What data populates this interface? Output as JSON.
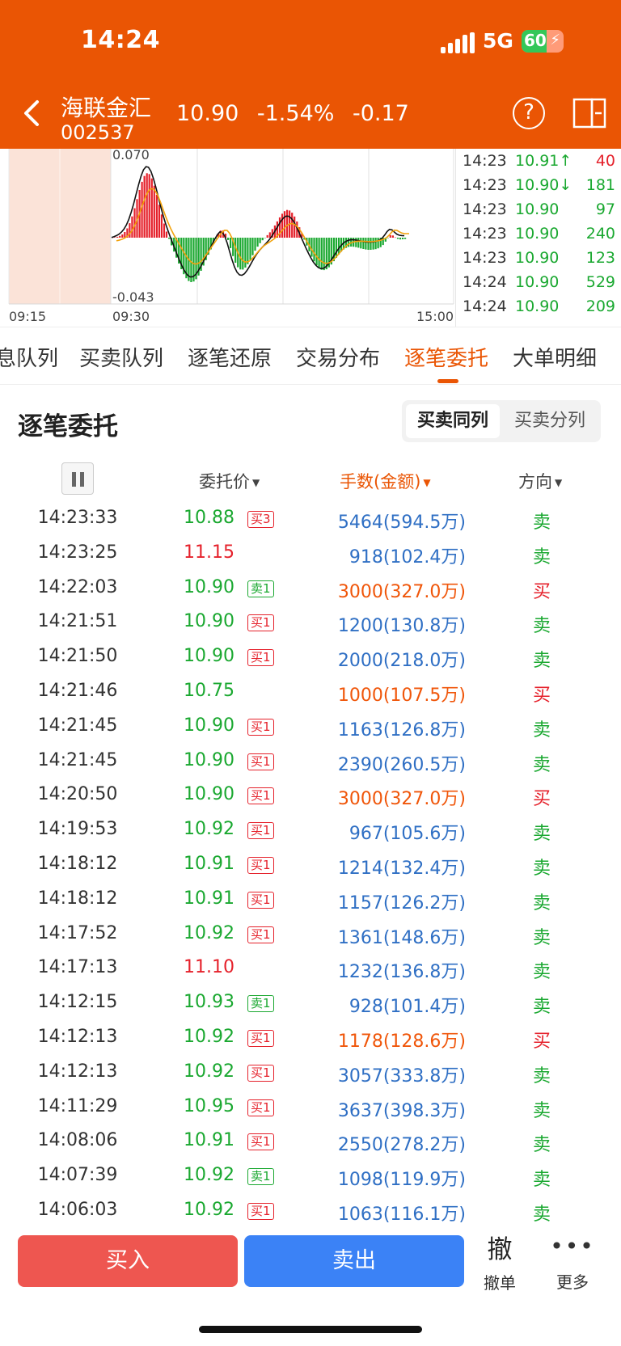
{
  "status_bar": {
    "time": "14:24",
    "network": "5G",
    "battery": "60",
    "battery_pct": 0.6
  },
  "stock": {
    "name": "海联金汇",
    "code": "002537",
    "price": "10.90",
    "change_pct": "-1.54%",
    "change": "-0.17"
  },
  "chart": {
    "y_top_label": "0.070",
    "y_bottom_label": "-0.043",
    "x_labels": [
      "09:15",
      "09:30",
      "15:00"
    ]
  },
  "tick_list": [
    {
      "time": "14:23",
      "price": "10.91↑",
      "volume": "40",
      "price_color": "green",
      "vol_color": "red"
    },
    {
      "time": "14:23",
      "price": "10.90↓",
      "volume": "181",
      "price_color": "green",
      "vol_color": "green"
    },
    {
      "time": "14:23",
      "price": "10.90",
      "volume": "97",
      "price_color": "green",
      "vol_color": "green"
    },
    {
      "time": "14:23",
      "price": "10.90",
      "volume": "240",
      "price_color": "green",
      "vol_color": "green"
    },
    {
      "time": "14:23",
      "price": "10.90",
      "volume": "123",
      "price_color": "green",
      "vol_color": "green"
    },
    {
      "time": "14:24",
      "price": "10.90",
      "volume": "529",
      "price_color": "green",
      "vol_color": "green"
    },
    {
      "time": "14:24",
      "price": "10.90",
      "volume": "209",
      "price_color": "green",
      "vol_color": "green"
    }
  ],
  "tabs": [
    "息队列",
    "买卖队列",
    "逐笔还原",
    "交易分布",
    "逐笔委托",
    "大单明细"
  ],
  "active_tab": "逐笔委托",
  "section": {
    "title": "逐笔委托",
    "toggle": [
      "买卖同列",
      "买卖分列"
    ],
    "toggle_active": "买卖同列"
  },
  "table_headers": {
    "price": "委托价",
    "volume": "手数(金额)",
    "direction": "方向"
  },
  "orders": [
    {
      "time": "14:23:33",
      "price": "10.88",
      "price_color": "green",
      "badge": "买3",
      "badge_type": "buy",
      "volume": "5464(594.5万)",
      "vol_color": "blue",
      "dir": "卖",
      "dir_color": "green"
    },
    {
      "time": "14:23:25",
      "price": "11.15",
      "price_color": "red",
      "badge": "",
      "badge_type": "",
      "volume": "918(102.4万)",
      "vol_color": "blue",
      "dir": "卖",
      "dir_color": "green"
    },
    {
      "time": "14:22:03",
      "price": "10.90",
      "price_color": "green",
      "badge": "卖1",
      "badge_type": "sell",
      "volume": "3000(327.0万)",
      "vol_color": "orange",
      "dir": "买",
      "dir_color": "red"
    },
    {
      "time": "14:21:51",
      "price": "10.90",
      "price_color": "green",
      "badge": "买1",
      "badge_type": "buy",
      "volume": "1200(130.8万)",
      "vol_color": "blue",
      "dir": "卖",
      "dir_color": "green"
    },
    {
      "time": "14:21:50",
      "price": "10.90",
      "price_color": "green",
      "badge": "买1",
      "badge_type": "buy",
      "volume": "2000(218.0万)",
      "vol_color": "blue",
      "dir": "卖",
      "dir_color": "green"
    },
    {
      "time": "14:21:46",
      "price": "10.75",
      "price_color": "green",
      "badge": "",
      "badge_type": "",
      "volume": "1000(107.5万)",
      "vol_color": "orange",
      "dir": "买",
      "dir_color": "red"
    },
    {
      "time": "14:21:45",
      "price": "10.90",
      "price_color": "green",
      "badge": "买1",
      "badge_type": "buy",
      "volume": "1163(126.8万)",
      "vol_color": "blue",
      "dir": "卖",
      "dir_color": "green"
    },
    {
      "time": "14:21:45",
      "price": "10.90",
      "price_color": "green",
      "badge": "买1",
      "badge_type": "buy",
      "volume": "2390(260.5万)",
      "vol_color": "blue",
      "dir": "卖",
      "dir_color": "green"
    },
    {
      "time": "14:20:50",
      "price": "10.90",
      "price_color": "green",
      "badge": "买1",
      "badge_type": "buy",
      "volume": "3000(327.0万)",
      "vol_color": "orange",
      "dir": "买",
      "dir_color": "red"
    },
    {
      "time": "14:19:53",
      "price": "10.92",
      "price_color": "green",
      "badge": "买1",
      "badge_type": "buy",
      "volume": "967(105.6万)",
      "vol_color": "blue",
      "dir": "卖",
      "dir_color": "green"
    },
    {
      "time": "14:18:12",
      "price": "10.91",
      "price_color": "green",
      "badge": "买1",
      "badge_type": "buy",
      "volume": "1214(132.4万)",
      "vol_color": "blue",
      "dir": "卖",
      "dir_color": "green"
    },
    {
      "time": "14:18:12",
      "price": "10.91",
      "price_color": "green",
      "badge": "买1",
      "badge_type": "buy",
      "volume": "1157(126.2万)",
      "vol_color": "blue",
      "dir": "卖",
      "dir_color": "green"
    },
    {
      "time": "14:17:52",
      "price": "10.92",
      "price_color": "green",
      "badge": "买1",
      "badge_type": "buy",
      "volume": "1361(148.6万)",
      "vol_color": "blue",
      "dir": "卖",
      "dir_color": "green"
    },
    {
      "time": "14:17:13",
      "price": "11.10",
      "price_color": "red",
      "badge": "",
      "badge_type": "",
      "volume": "1232(136.8万)",
      "vol_color": "blue",
      "dir": "卖",
      "dir_color": "green"
    },
    {
      "time": "14:12:15",
      "price": "10.93",
      "price_color": "green",
      "badge": "卖1",
      "badge_type": "sell",
      "volume": "928(101.4万)",
      "vol_color": "blue",
      "dir": "卖",
      "dir_color": "green"
    },
    {
      "time": "14:12:13",
      "price": "10.92",
      "price_color": "green",
      "badge": "买1",
      "badge_type": "buy",
      "volume": "1178(128.6万)",
      "vol_color": "orange",
      "dir": "买",
      "dir_color": "red"
    },
    {
      "time": "14:12:13",
      "price": "10.92",
      "price_color": "green",
      "badge": "买1",
      "badge_type": "buy",
      "volume": "3057(333.8万)",
      "vol_color": "blue",
      "dir": "卖",
      "dir_color": "green"
    },
    {
      "time": "14:11:29",
      "price": "10.95",
      "price_color": "green",
      "badge": "买1",
      "badge_type": "buy",
      "volume": "3637(398.3万)",
      "vol_color": "blue",
      "dir": "卖",
      "dir_color": "green"
    },
    {
      "time": "14:08:06",
      "price": "10.91",
      "price_color": "green",
      "badge": "买1",
      "badge_type": "buy",
      "volume": "2550(278.2万)",
      "vol_color": "blue",
      "dir": "卖",
      "dir_color": "green"
    },
    {
      "time": "14:07:39",
      "price": "10.92",
      "price_color": "green",
      "badge": "卖1",
      "badge_type": "sell",
      "volume": "1098(119.9万)",
      "vol_color": "blue",
      "dir": "卖",
      "dir_color": "green"
    },
    {
      "time": "14:06:03",
      "price": "10.92",
      "price_color": "green",
      "badge": "买1",
      "badge_type": "buy",
      "volume": "1063(116.1万)",
      "vol_color": "blue",
      "dir": "卖",
      "dir_color": "green"
    }
  ],
  "bottom_bar": {
    "buy": "买入",
    "sell": "卖出",
    "cancel_char": "撤",
    "cancel": "撤单",
    "more": "更多"
  },
  "colors": {
    "header": "#ea5504",
    "green": "#1aa830",
    "red": "#e5212b",
    "blue": "#2f6fc4",
    "orange": "#f0560a",
    "buy_button": "#ee5650",
    "sell_button": "#3b82f6"
  }
}
